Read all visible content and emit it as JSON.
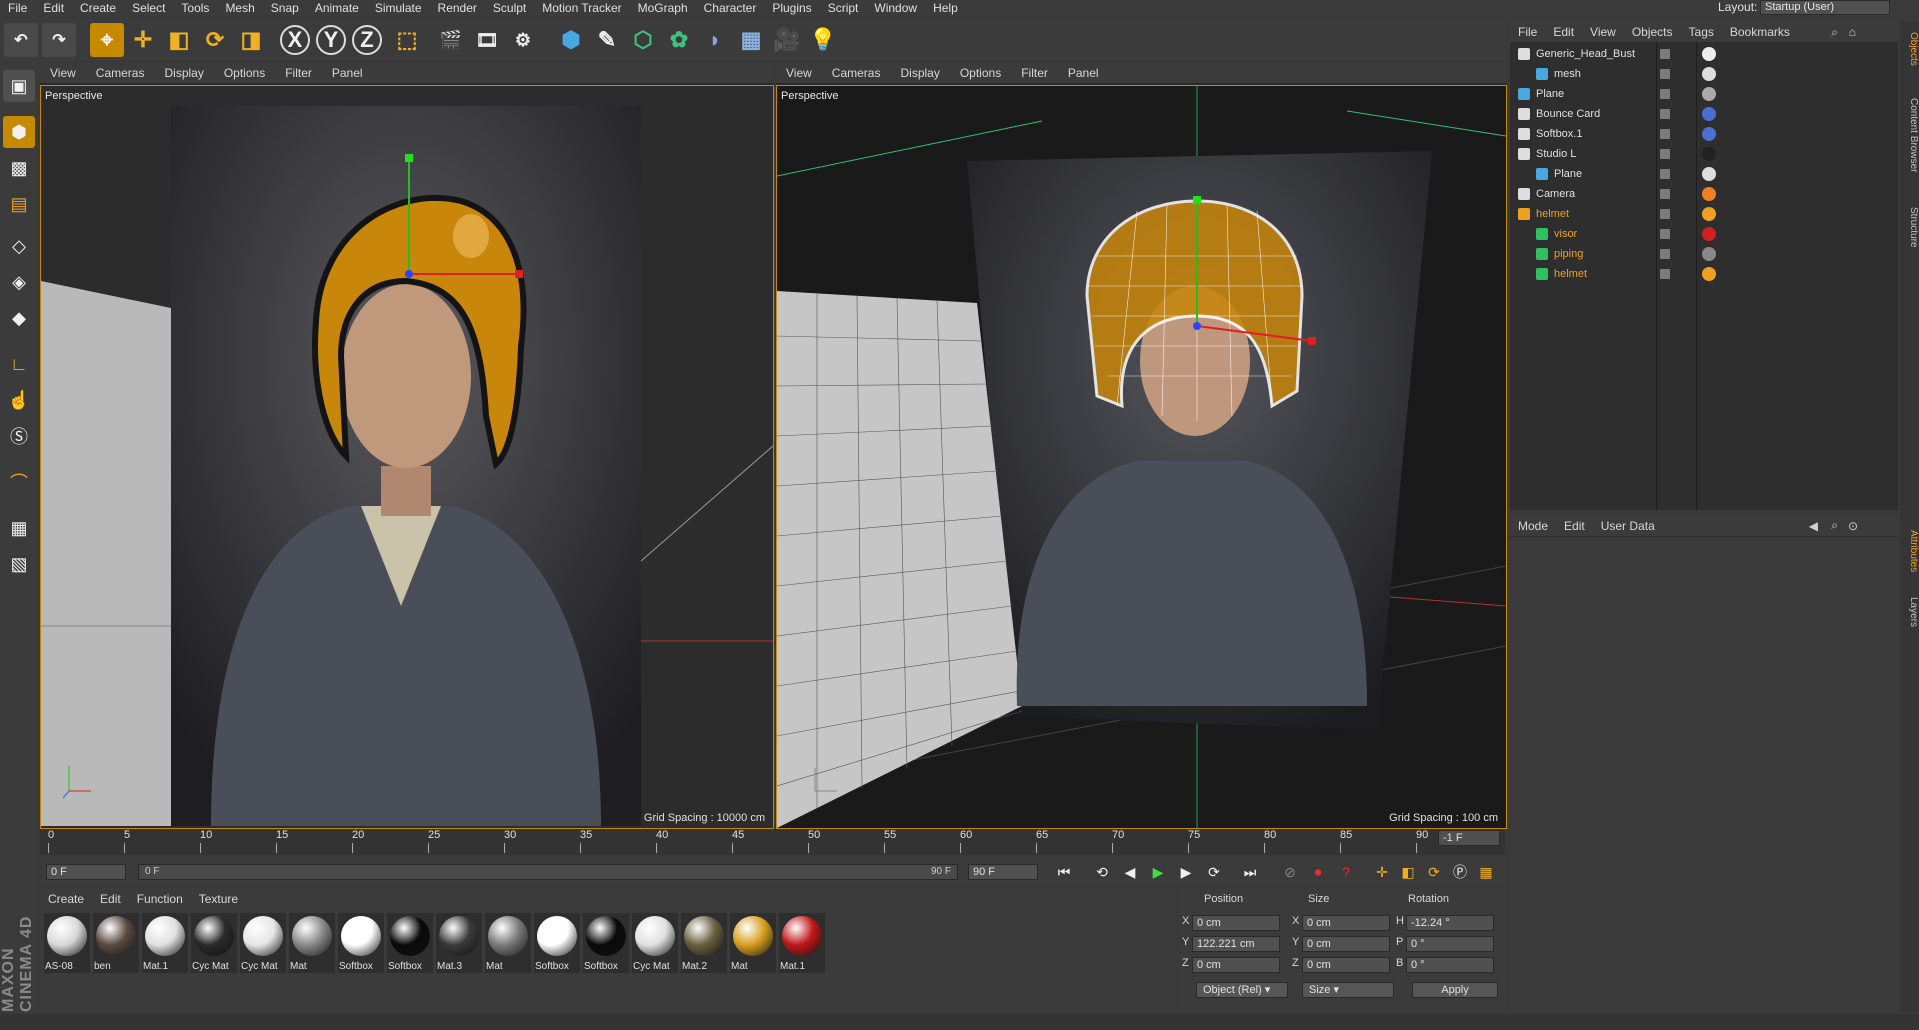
{
  "menubar": {
    "items": [
      "File",
      "Edit",
      "Create",
      "Select",
      "Tools",
      "Mesh",
      "Snap",
      "Animate",
      "Simulate",
      "Render",
      "Sculpt",
      "Motion Tracker",
      "MoGraph",
      "Character",
      "Plugins",
      "Script",
      "Window",
      "Help"
    ],
    "layout_label": "Layout:",
    "layout_value": "Startup (User)"
  },
  "toolbar": {
    "axis_x": "X",
    "axis_y": "Y",
    "axis_z": "Z",
    "icons": [
      "undo-icon",
      "redo-icon",
      "select-icon",
      "move-icon",
      "scale-icon",
      "rotate-icon",
      "recent-tool-icon",
      "x-axis-icon",
      "y-axis-icon",
      "z-axis-icon",
      "coord-system-icon",
      "render-view-icon",
      "render-picture-viewer-icon",
      "render-settings-icon",
      "cube-icon",
      "pen-icon",
      "subdivision-icon",
      "cloner-icon",
      "deformer-icon",
      "floor-icon",
      "camera-icon",
      "light-icon"
    ]
  },
  "viewports": [
    {
      "menu": [
        "View",
        "Cameras",
        "Display",
        "Options",
        "Filter",
        "Panel"
      ],
      "label": "Perspective",
      "grid_spacing": "Grid Spacing : 10000 cm"
    },
    {
      "menu": [
        "View",
        "Cameras",
        "Display",
        "Options",
        "Filter",
        "Panel"
      ],
      "label": "Perspective",
      "grid_spacing": "Grid Spacing : 100 cm"
    }
  ],
  "object_manager": {
    "menu": [
      "File",
      "Edit",
      "View",
      "Objects",
      "Tags",
      "Bookmarks"
    ],
    "objects": [
      {
        "name": "Generic_Head_Bust",
        "indent": 0,
        "selected": false
      },
      {
        "name": "mesh",
        "indent": 1,
        "selected": false
      },
      {
        "name": "Plane",
        "indent": 0,
        "selected": false
      },
      {
        "name": "Bounce Card",
        "indent": 0,
        "selected": false
      },
      {
        "name": "Softbox.1",
        "indent": 0,
        "selected": false
      },
      {
        "name": "Studio L",
        "indent": 0,
        "selected": false
      },
      {
        "name": "Plane",
        "indent": 1,
        "selected": false
      },
      {
        "name": "Camera",
        "indent": 0,
        "selected": false
      },
      {
        "name": "helmet",
        "indent": 0,
        "selected": true
      },
      {
        "name": "visor",
        "indent": 1,
        "selected": true
      },
      {
        "name": "piping",
        "indent": 1,
        "selected": true
      },
      {
        "name": "helmet",
        "indent": 1,
        "selected": true
      }
    ]
  },
  "attribute_manager": {
    "menu": [
      "Mode",
      "Edit",
      "User Data"
    ]
  },
  "side_tabs": [
    "Objects",
    "Content Browser",
    "Structure",
    "Attributes",
    "Layers"
  ],
  "timeline": {
    "ticks": [
      "0",
      "5",
      "10",
      "15",
      "20",
      "25",
      "30",
      "35",
      "40",
      "45",
      "50",
      "55",
      "60",
      "65",
      "70",
      "75",
      "80",
      "85",
      "90"
    ],
    "end_frame_field": "-1 F"
  },
  "transport": {
    "current_frame": "0 F",
    "range_start": "0 F",
    "range_end": "90 F",
    "max_frame": "90 F"
  },
  "material_manager": {
    "menu": [
      "Create",
      "Edit",
      "Function",
      "Texture"
    ],
    "materials": [
      {
        "name": "AS-08",
        "color": "#d8d8d8"
      },
      {
        "name": "ben",
        "color": "#5a4a40"
      },
      {
        "name": "Mat.1",
        "color": "#e0e0e0"
      },
      {
        "name": "Cyc Mat",
        "color": "#2a2a2a"
      },
      {
        "name": "Cyc Mat",
        "color": "#e6e6e6"
      },
      {
        "name": "Mat",
        "color": "#8a8a8a"
      },
      {
        "name": "Softbox",
        "color": "#ffffff"
      },
      {
        "name": "Softbox",
        "color": "#0a0a0a"
      },
      {
        "name": "Mat.3",
        "color": "#3a3a3a"
      },
      {
        "name": "Mat",
        "color": "#7a7a7a"
      },
      {
        "name": "Softbox",
        "color": "#ffffff"
      },
      {
        "name": "Softbox",
        "color": "#0a0a0a"
      },
      {
        "name": "Cyc Mat",
        "color": "#e0e0e0"
      },
      {
        "name": "Mat.2",
        "color": "#6a6040"
      },
      {
        "name": "Mat",
        "color": "#d8a020"
      },
      {
        "name": "Mat.1",
        "color": "#c01818"
      }
    ]
  },
  "coordinates": {
    "headers": {
      "position": "Position",
      "size": "Size",
      "rotation": "Rotation"
    },
    "rows": [
      {
        "axis": "X",
        "position": "0 cm",
        "size_axis": "X",
        "size": "0 cm",
        "rot_axis": "H",
        "rotation": "-12.24 °"
      },
      {
        "axis": "Y",
        "position": "122.221 cm",
        "size_axis": "Y",
        "size": "0 cm",
        "rot_axis": "P",
        "rotation": "0 °"
      },
      {
        "axis": "Z",
        "position": "0 cm",
        "size_axis": "Z",
        "size": "0 cm",
        "rot_axis": "B",
        "rotation": "0 °"
      }
    ],
    "mode_select": "Object (Rel)",
    "size_select": "Size",
    "apply_label": "Apply"
  },
  "brand": {
    "text": "MAXON CINEMA 4D"
  },
  "colors": {
    "accent": "#c68a00",
    "selected_text": "#f0a020",
    "helmet": "#c8860a"
  }
}
